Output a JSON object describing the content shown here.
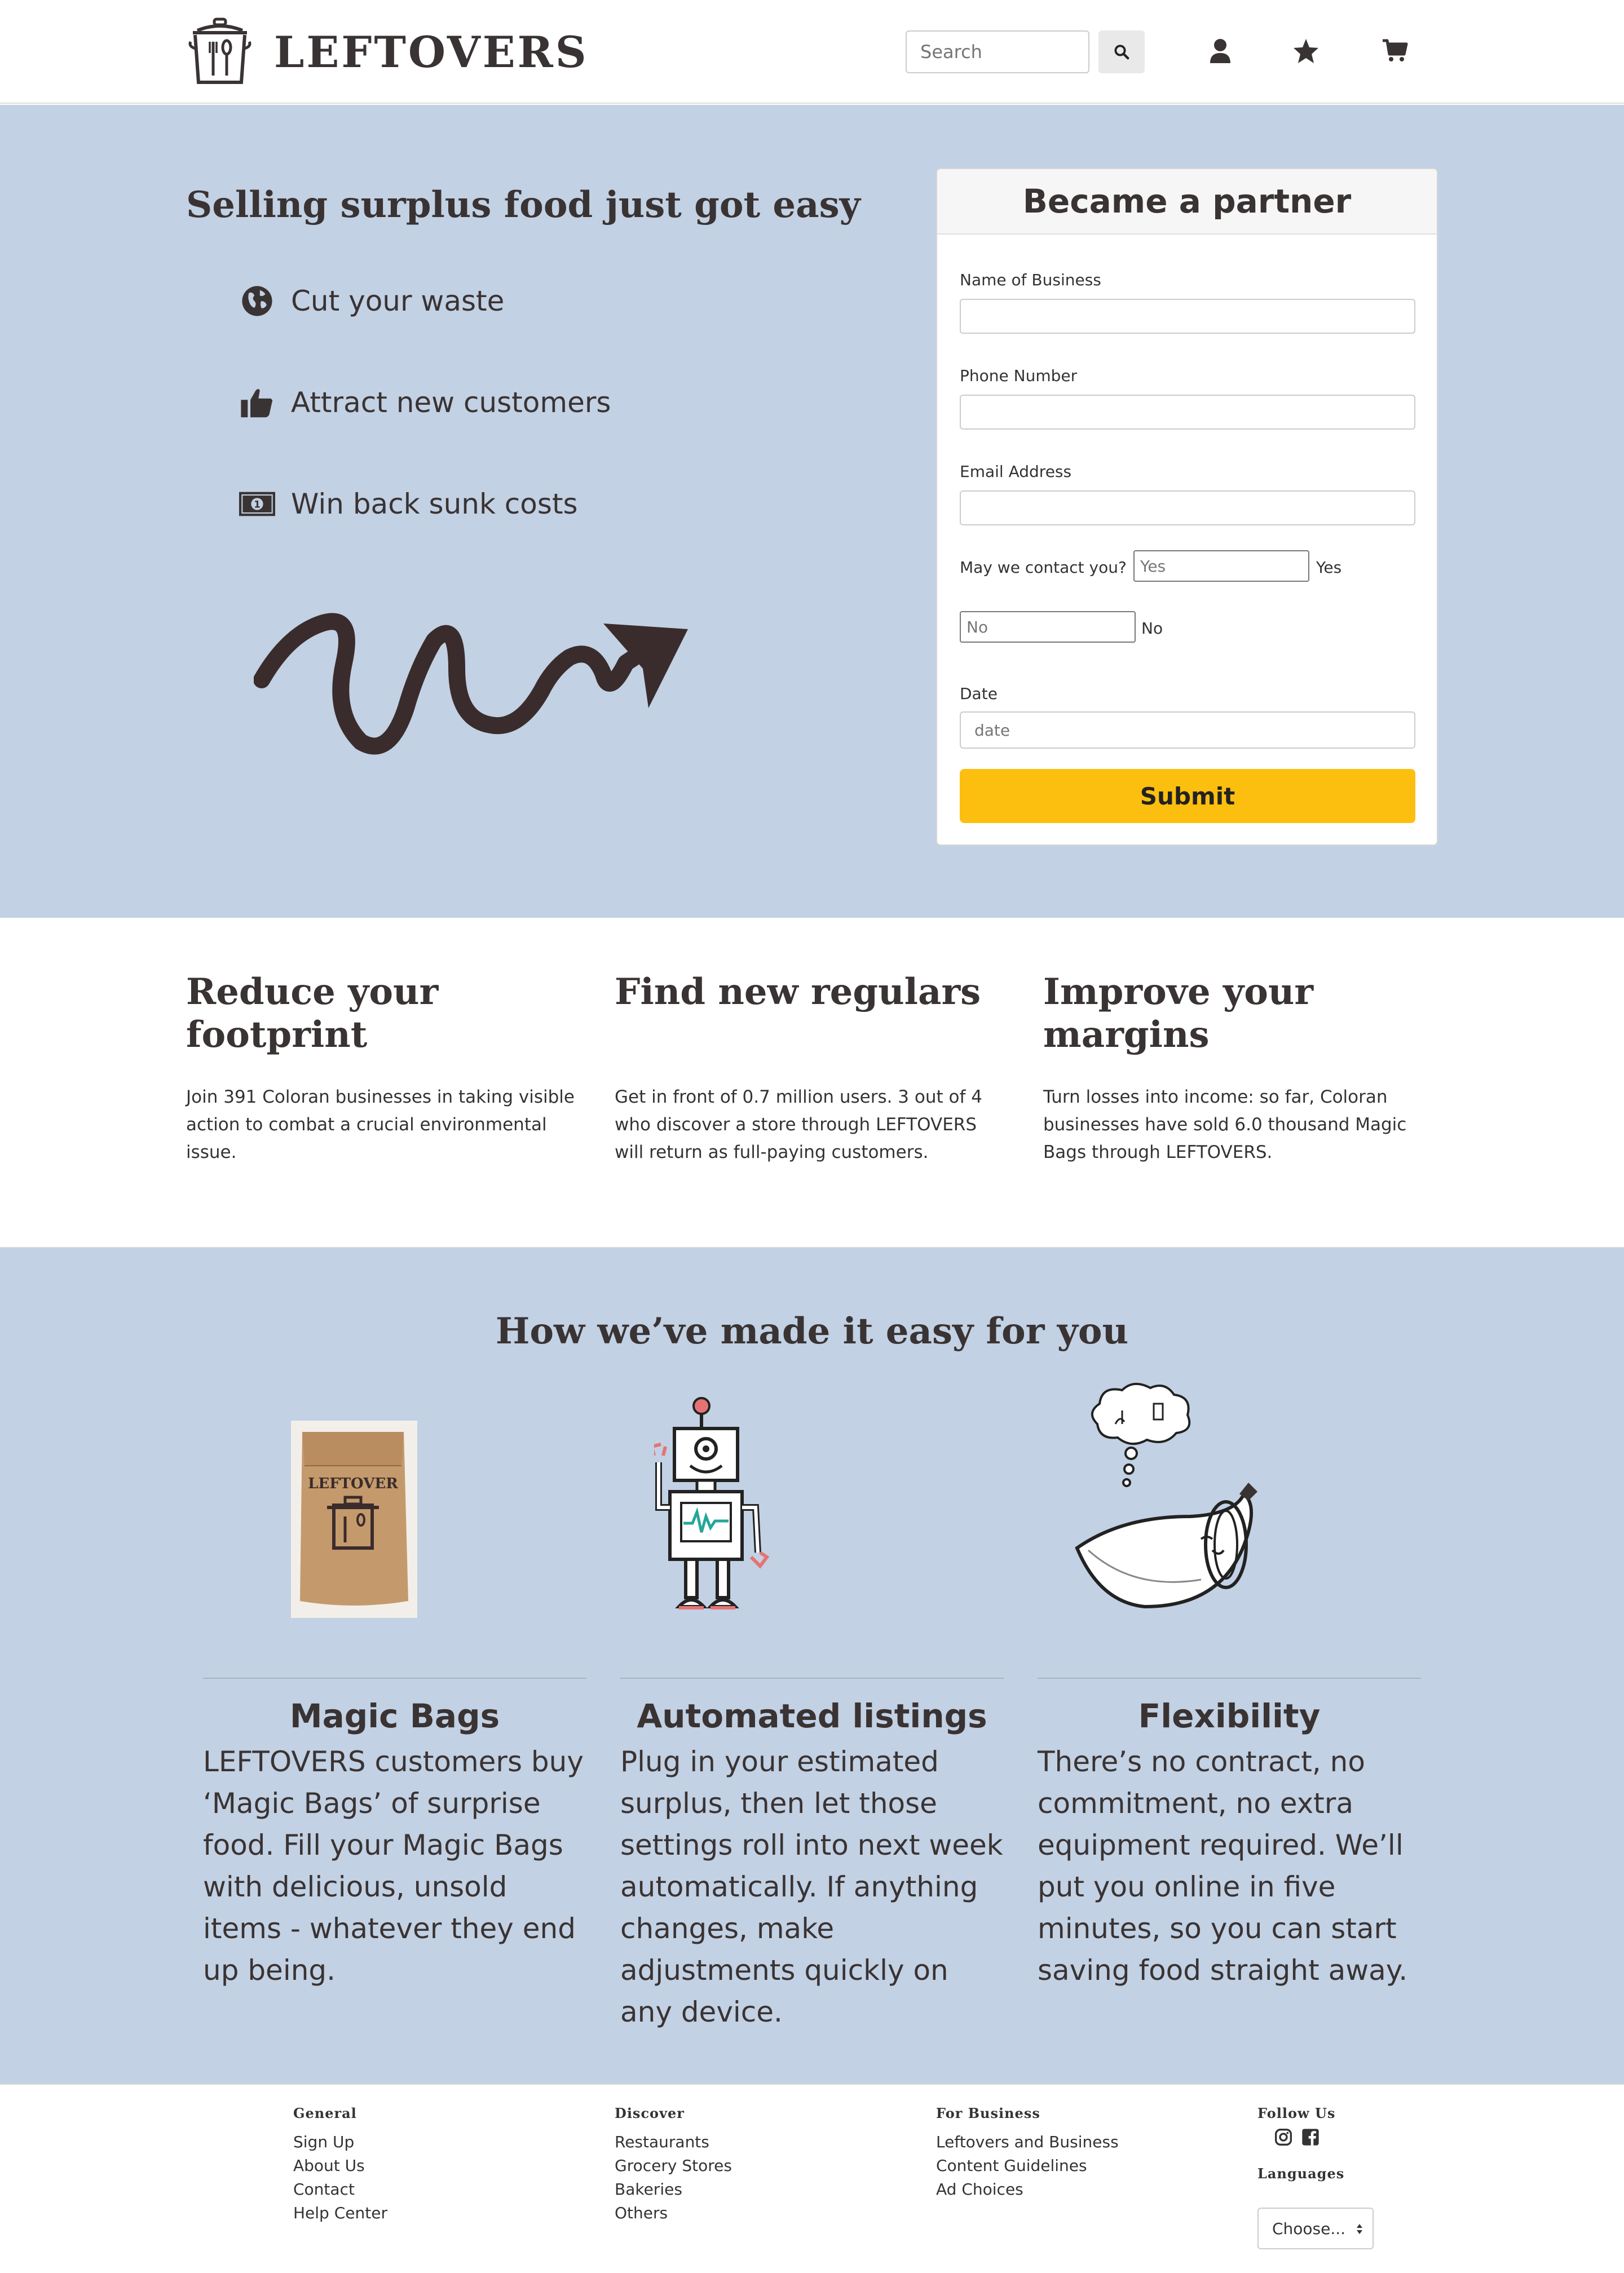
{
  "header": {
    "brand": "LEFTOVERS",
    "search_placeholder": "Search",
    "icons": [
      "search-icon",
      "user-icon",
      "star-icon",
      "cart-icon"
    ]
  },
  "hero": {
    "title": "Selling surplus food just got easy",
    "benefits": [
      {
        "icon": "globe-icon",
        "label": "Cut your waste"
      },
      {
        "icon": "thumbs-up-icon",
        "label": "Attract new customers"
      },
      {
        "icon": "money-icon",
        "label": "Win back sunk costs"
      }
    ],
    "form": {
      "title": "Became a partner",
      "name_label": "Name of Business",
      "phone_label": "Phone Number",
      "email_label": "Email Address",
      "contact_label": "May we contact you?",
      "yes_value": "Yes",
      "yes_label": "Yes",
      "no_value": "No",
      "no_label": "No",
      "date_label": "Date",
      "date_placeholder": "date",
      "submit_label": "Submit"
    }
  },
  "features": [
    {
      "title": "Reduce your footprint",
      "text": "Join 391 Coloran businesses in taking visible action to combat a crucial environmental issue."
    },
    {
      "title": "Find new regulars",
      "text": "Get in front of 0.7 million users. 3 out of 4 who discover a store through LEFTOVERS will return as full-paying customers."
    },
    {
      "title": "Improve your margins",
      "text": "Turn losses into income: so far, Coloran businesses have sold 6.0 thousand Magic Bags through LEFTOVERS."
    }
  ],
  "how": {
    "title": "How we’ve made it easy for you",
    "bag_text": "LEFTOVER",
    "columns": [
      {
        "title": "Magic Bags",
        "text": "LEFTOVERS customers buy ‘Magic Bags’ of surprise food. Fill your Magic Bags with delicious, unsold items - whatever they end up being."
      },
      {
        "title": "Automated listings",
        "text": "Plug in your estimated surplus, then let those settings roll into next week automatically. If anything changes, make adjustments quickly on any device."
      },
      {
        "title": "Flexibility",
        "text": "There’s no contract, no commitment, no extra equipment required. We’ll put you online in five minutes, so you can start saving food straight away."
      }
    ]
  },
  "footer": {
    "general": {
      "title": "General",
      "links": [
        "Sign Up",
        "About Us",
        "Contact",
        "Help Center"
      ]
    },
    "discover": {
      "title": "Discover",
      "links": [
        "Restaurants",
        "Grocery Stores",
        "Bakeries",
        "Others"
      ]
    },
    "business": {
      "title": "For Business",
      "links": [
        "Leftovers and Business",
        "Content Guidelines",
        "Ad Choices"
      ]
    },
    "follow": {
      "title": "Follow Us",
      "icons": [
        "instagram-icon",
        "facebook-icon"
      ]
    },
    "languages": {
      "title": "Languages",
      "selected": "Choose..."
    }
  }
}
